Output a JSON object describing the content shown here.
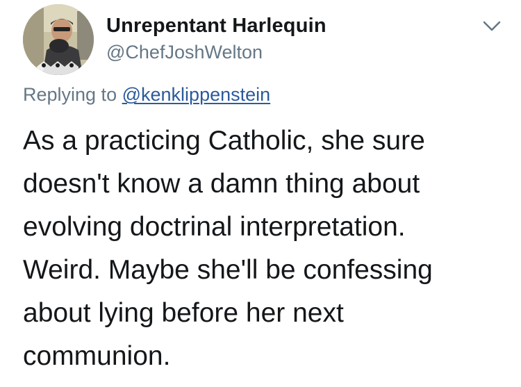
{
  "tweet": {
    "display_name": "Unrepentant Harlequin",
    "handle": "@ChefJoshWelton",
    "replying_prefix": "Replying to",
    "replying_to": "@kenklippenstein",
    "body_lines": [
      "As a practicing Catholic, she sure",
      "doesn't know a damn thing about",
      "evolving doctrinal interpretation.",
      "Weird. Maybe she'll be confessing",
      "about lying before her next",
      "communion."
    ]
  },
  "icons": {
    "menu": "chevron-down-icon",
    "avatar": "avatar"
  },
  "colors": {
    "name_text": "#14171a",
    "secondary_text": "#657786",
    "link": "#2b5a9b",
    "background": "#ffffff"
  }
}
